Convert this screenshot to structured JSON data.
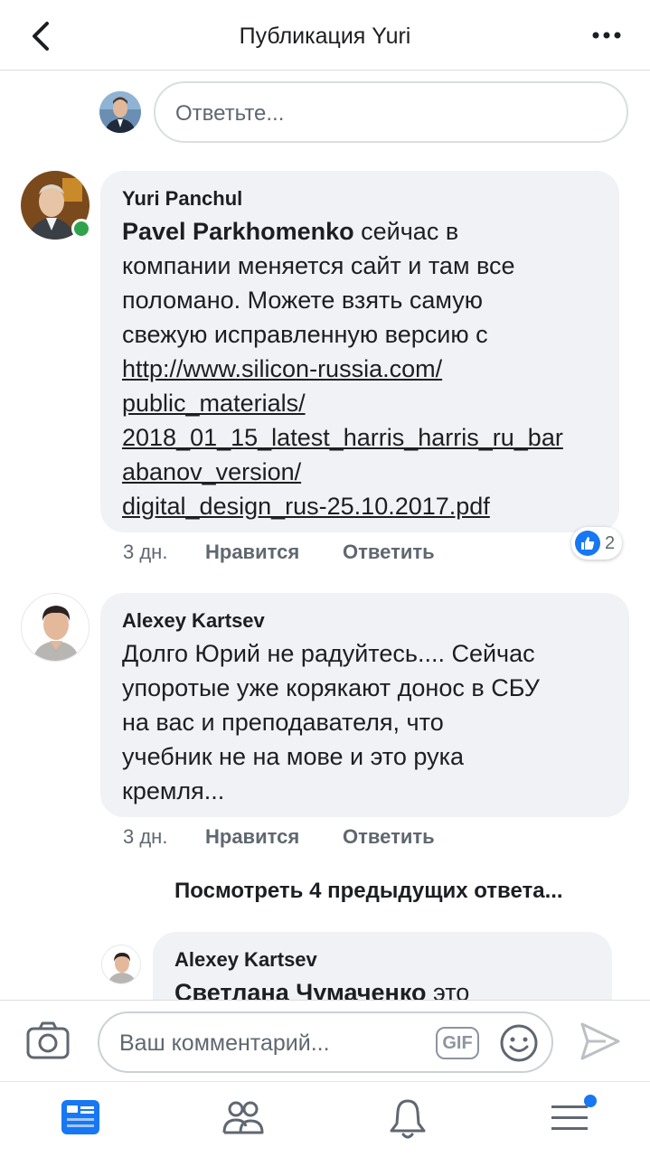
{
  "header": {
    "title": "Публикация Yuri"
  },
  "reply_box": {
    "placeholder": "Ответьте..."
  },
  "comments": [
    {
      "author": "Yuri Panchul",
      "mention": "Pavel Parkhomenko",
      "text_lines": [
        "сейчас в",
        "компании меняется сайт и там все",
        "поломано. Можете взять самую",
        "свежую исправленную версию с"
      ],
      "link_lines": [
        "http://www.silicon-russia.com/",
        "public_materials/",
        "2018_01_15_latest_harris_harris_ru_bar",
        "abanov_version/",
        "digital_design_rus-25.10.2017.pdf"
      ],
      "time": "3 дн.",
      "like_label": "Нравится",
      "reply_label": "Ответить",
      "reaction_count": "2",
      "online": true
    },
    {
      "author": "Alexey Kartsev",
      "text_lines": [
        "Долго Юрий не радуйтесь.... Сейчас",
        "упоротые уже корякают донос в СБУ",
        "на вас и преподавателя, что",
        "учебник не на мове и это рука",
        "кремля..."
      ],
      "time": "3 дн.",
      "like_label": "Нравится",
      "reply_label": "Ответить"
    }
  ],
  "view_previous": "Посмотреть 4 предыдущих ответа...",
  "nested_reply": {
    "author": "Alexey Kartsev",
    "mention": "Светлана Чумаченко",
    "text": "это"
  },
  "composer": {
    "placeholder": "Ваш комментарий...",
    "gif_label": "GIF"
  },
  "colors": {
    "accent": "#1877f2",
    "online": "#31a24c",
    "bubble": "#f0f2f5"
  },
  "bottom_nav": [
    "news-feed-icon",
    "friends-icon",
    "notifications-icon",
    "menu-icon"
  ]
}
